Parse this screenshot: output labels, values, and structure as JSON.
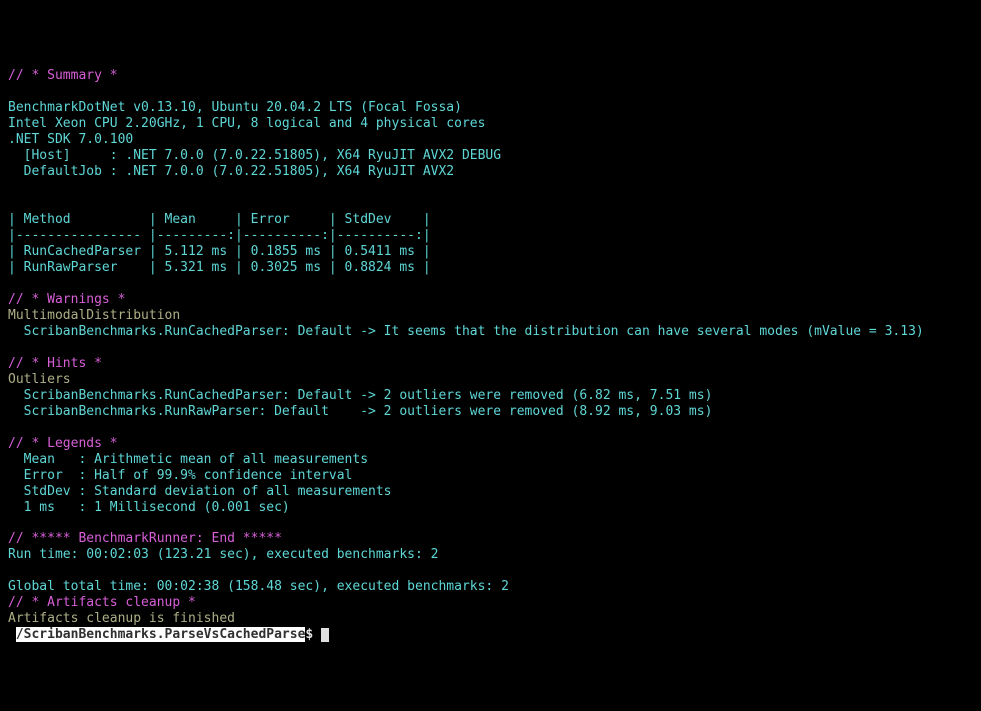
{
  "summary": {
    "heading": "// * Summary *",
    "line1": "BenchmarkDotNet v0.13.10, Ubuntu 20.04.2 LTS (Focal Fossa)",
    "line2": "Intel Xeon CPU 2.20GHz, 1 CPU, 8 logical and 4 physical cores",
    "line3": ".NET SDK 7.0.100",
    "line4": "  [Host]     : .NET 7.0.0 (7.0.22.51805), X64 RyuJIT AVX2 DEBUG",
    "line5": "  DefaultJob : .NET 7.0.0 (7.0.22.51805), X64 RyuJIT AVX2"
  },
  "table": {
    "header": "| Method          | Mean     | Error     | StdDev    |",
    "separator": "|---------------- |---------:|----------:|----------:|",
    "row1": "| RunCachedParser | 5.112 ms | 0.1855 ms | 0.5411 ms |",
    "row2": "| RunRawParser    | 5.321 ms | 0.3025 ms | 0.8824 ms |"
  },
  "warnings": {
    "heading": "// * Warnings *",
    "type": "MultimodalDistribution",
    "detail": "  ScribanBenchmarks.RunCachedParser: Default -> It seems that the distribution can have several modes (mValue = 3.13)"
  },
  "hints": {
    "heading": "// * Hints *",
    "type": "Outliers",
    "line1": "  ScribanBenchmarks.RunCachedParser: Default -> 2 outliers were removed (6.82 ms, 7.51 ms)",
    "line2": "  ScribanBenchmarks.RunRawParser: Default    -> 2 outliers were removed (8.92 ms, 9.03 ms)"
  },
  "legends": {
    "heading": "// * Legends *",
    "line1": "  Mean   : Arithmetic mean of all measurements",
    "line2": "  Error  : Half of 99.9% confidence interval",
    "line3": "  StdDev : Standard deviation of all measurements",
    "line4": "  1 ms   : 1 Millisecond (0.001 sec)"
  },
  "runner_end": {
    "heading": "// ***** BenchmarkRunner: End *****"
  },
  "timing": {
    "run_time": "Run time: 00:02:03 (123.21 sec), executed benchmarks: 2",
    "global_time": "Global total time: 00:02:38 (158.48 sec), executed benchmarks: 2"
  },
  "artifacts": {
    "heading": "// * Artifacts cleanup *",
    "finished": "Artifacts cleanup is finished"
  },
  "prompt": {
    "path": "/ScribanBenchmarks.ParseVsCachedParse",
    "dollar": "$"
  }
}
